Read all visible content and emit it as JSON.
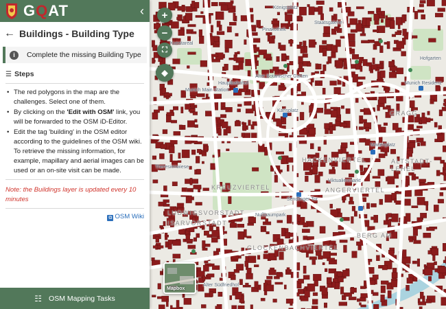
{
  "app": {
    "logo_text_pre": "G",
    "logo_text_accent": "Q",
    "logo_text_post": "AT"
  },
  "header": {
    "collapse_icon": "chevron-left-icon"
  },
  "page": {
    "title": "Buildings - Building Type"
  },
  "task": {
    "text": "Complete the missing Building Type"
  },
  "steps": {
    "title": "Steps",
    "items": [
      {
        "pre": "The red polygons in the map are the challenges. Select one of them.",
        "bold": "",
        "post": ""
      },
      {
        "pre": "By clicking on the ",
        "bold": "'Edit with OSM'",
        "post": " link, you will be forwarded to the OSM iD-Editor."
      },
      {
        "pre": "Edit the tag 'building' in the OSM editor according to the guidelines of the OSM wiki. To retrieve the missing information, for example, mapillary and aerial images can be used or an on-site visit can be made.",
        "bold": "",
        "post": ""
      }
    ]
  },
  "note": "Note: the Buildings layer is updated every 10 minutes",
  "wiki": {
    "label": "OSM Wiki"
  },
  "footer": {
    "label": "OSM Mapping Tasks"
  },
  "map": {
    "basemap_label": "Mapbox",
    "labels": [
      "Königsplatz",
      "Munich Main Station",
      "Hauptbahnhof",
      "Alter Botanischer Garten",
      "Karlsplatz",
      "Marienplatz",
      "Sendlinger Tor",
      "Munich Residenz",
      "Hofgarten",
      "Viktualienmarkt",
      "Nußbaumpark",
      "Kunstareal",
      "Staatsgalerie",
      "Alter Südfriedhof",
      "Theresienwiese",
      "Pinakothek"
    ],
    "districts": [
      "GRAGG",
      "HACKENVIERTEL",
      "ISARVORSTADT",
      "LUDWIGSVORSTADT",
      "ANGERVIERTEL",
      "GLOCKENBACHVIERTEL",
      "ALTSTADT-LEHEL",
      "BERG AM",
      "KREUZVIERTEL"
    ],
    "colors": {
      "building": "#8b1c1c",
      "park": "#cfe4c4",
      "road": "#ffffff",
      "water": "#aad3df"
    }
  },
  "colors": {
    "accent": "#52785a",
    "note": "#d0342c",
    "link": "#2a6ebb"
  }
}
